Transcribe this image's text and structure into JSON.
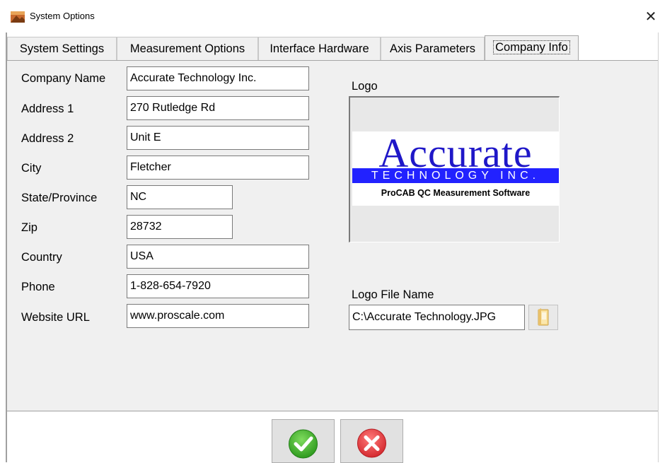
{
  "window": {
    "title": "System Options",
    "close_glyph": "✕",
    "icon": "app-icon"
  },
  "tabs": [
    {
      "label": "System Settings",
      "active": false
    },
    {
      "label": "Measurement Options",
      "active": false
    },
    {
      "label": "Interface Hardware",
      "active": false
    },
    {
      "label": "Axis Parameters",
      "active": false
    },
    {
      "label": "Company Info",
      "active": true
    }
  ],
  "form": {
    "company_name": {
      "label": "Company Name",
      "value": "Accurate Technology Inc."
    },
    "address1": {
      "label": "Address 1",
      "value": "270 Rutledge Rd"
    },
    "address2": {
      "label": "Address 2",
      "value": "Unit E"
    },
    "city": {
      "label": "City",
      "value": "Fletcher"
    },
    "state": {
      "label": "State/Province",
      "value": "NC"
    },
    "zip": {
      "label": "Zip",
      "value": "28732"
    },
    "country": {
      "label": "Country",
      "value": "USA"
    },
    "phone": {
      "label": "Phone",
      "value": "1-828-654-7920"
    },
    "website": {
      "label": "Website URL",
      "value": "www.proscale.com"
    }
  },
  "logo": {
    "label": "Logo",
    "image_word": "Accurate",
    "image_band": "TECHNOLOGY INC.",
    "image_tagline": "ProCAB QC  Measurement Software",
    "file_label": "Logo File Name",
    "file_value": "C:\\Accurate Technology.JPG",
    "browse_icon": "folder-icon"
  },
  "buttons": {
    "ok_icon": "checkmark-icon",
    "cancel_icon": "cancel-x-icon"
  },
  "colors": {
    "panel_bg": "#f0f0f0",
    "logo_blue": "#1f17c8",
    "band_blue": "#2222ff",
    "ok_green": "#3fae2a",
    "cancel_red": "#e0393e"
  }
}
